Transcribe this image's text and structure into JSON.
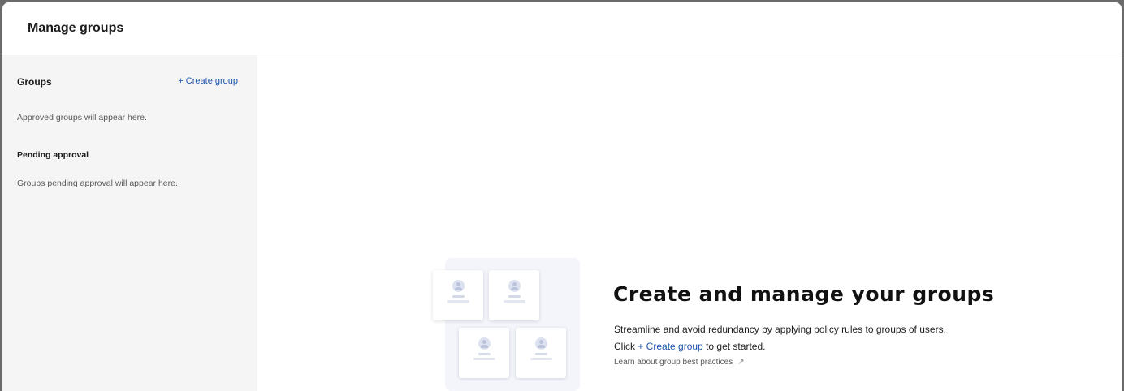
{
  "header": {
    "title": "Manage groups"
  },
  "sidebar": {
    "groups_heading": "Groups",
    "create_group_label": "+ Create group",
    "approved_empty": "Approved groups will appear here.",
    "pending_heading": "Pending approval",
    "pending_empty": "Groups pending approval will appear here."
  },
  "empty_state": {
    "title": "Create and manage your groups",
    "description": "Streamline and avoid redundancy by applying policy rules to groups of users.",
    "click_prefix": "Click",
    "click_link": "+ Create group",
    "click_suffix": "to get started.",
    "learn_link": "Learn about group best practices",
    "learn_icon": "external-link-icon",
    "illustration_icon": "group-cards-illustration"
  },
  "colors": {
    "link": "#1a55a8",
    "sidebar_bg": "#f5f5f6"
  }
}
